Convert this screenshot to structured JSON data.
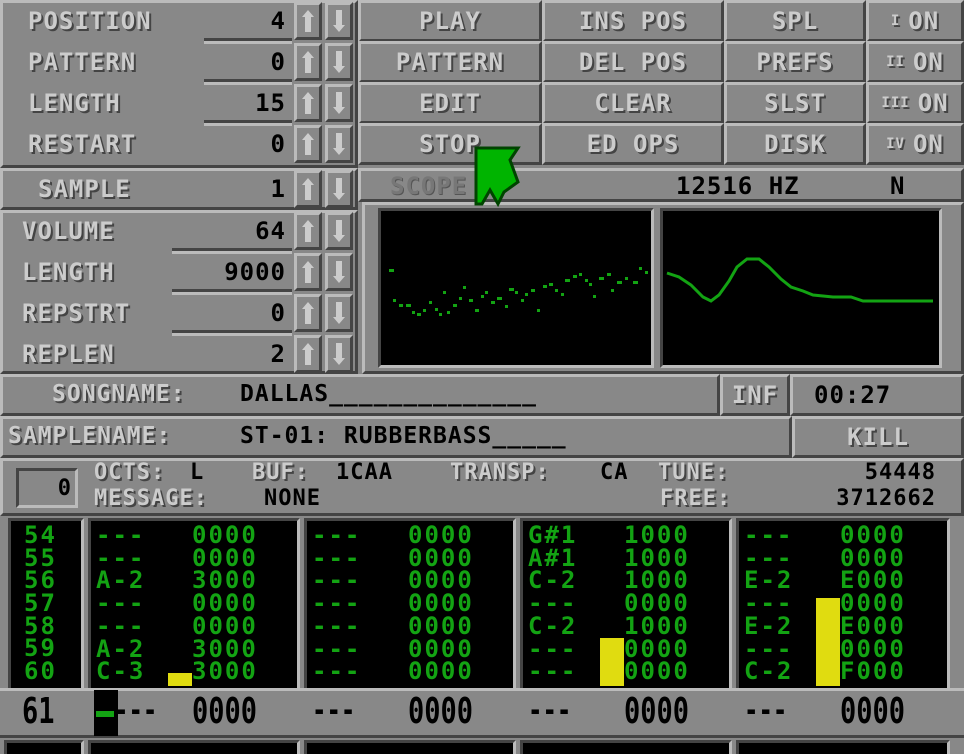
{
  "song_controls": [
    {
      "label": "POSITION",
      "value": "4"
    },
    {
      "label": "PATTERN",
      "value": "0"
    },
    {
      "label": "LENGTH",
      "value": "15"
    },
    {
      "label": "RESTART",
      "value": "0"
    }
  ],
  "transport_buttons": [
    "PLAY",
    "PATTERN",
    "EDIT",
    "STOP"
  ],
  "edit_buttons": [
    "INS POS",
    "DEL POS",
    "CLEAR",
    "ED OPS"
  ],
  "menu_buttons": [
    "SPL",
    "PREFS",
    "SLST",
    "DISK"
  ],
  "channel_toggles": [
    {
      "roman": "I",
      "state": "ON"
    },
    {
      "roman": "II",
      "state": "ON"
    },
    {
      "roman": "III",
      "state": "ON"
    },
    {
      "roman": "IV",
      "state": "ON"
    }
  ],
  "sample": {
    "label": "SAMPLE",
    "value": "1"
  },
  "sample_controls": [
    {
      "label": "VOLUME",
      "value": "64"
    },
    {
      "label": "LENGTH",
      "value": "9000"
    },
    {
      "label": "REPSTRT",
      "value": "0"
    },
    {
      "label": "REPLEN",
      "value": "2"
    }
  ],
  "scope": {
    "label": "SCOPE",
    "frequency": "12516 HZ",
    "mode": "N"
  },
  "songname": {
    "label": "SONGNAME:",
    "value": "DALLAS______________"
  },
  "inf_button": "INF",
  "time": "00:27",
  "samplename": {
    "label": "SAMPLENAME:",
    "value": "ST-01: RUBBERBASS_____"
  },
  "kill_button": "KILL",
  "status": {
    "octave_box": "0",
    "octs_label": "OCTS:",
    "octs_value": "L",
    "buf_label": "BUF:",
    "buf_value": "1CAA",
    "transp_label": "TRANSP:",
    "transp_value": "CA",
    "tune_label": "TUNE:",
    "tune_value": "54448",
    "message_label": "MESSAGE:",
    "message_value": "NONE",
    "free_label": "FREE:",
    "free_value": "3712662"
  },
  "pattern": {
    "row_numbers": [
      "54",
      "55",
      "56",
      "57",
      "58",
      "59",
      "60"
    ],
    "channels": [
      {
        "notes": [
          "---",
          "---",
          "A-2",
          "---",
          "---",
          "A-2",
          "C-3"
        ],
        "effects": [
          "0000",
          "0000",
          "3000",
          "0000",
          "0000",
          "3000",
          "3000"
        ],
        "vu_level": 0.08
      },
      {
        "notes": [
          "---",
          "---",
          "---",
          "---",
          "---",
          "---",
          "---"
        ],
        "effects": [
          "0000",
          "0000",
          "0000",
          "0000",
          "0000",
          "0000",
          "0000"
        ],
        "vu_level": 0
      },
      {
        "notes": [
          "G#1",
          "A#1",
          "C-2",
          "---",
          "C-2",
          "---",
          "---"
        ],
        "effects": [
          "1000",
          "1000",
          "1000",
          "0000",
          "1000",
          "0000",
          "0000"
        ],
        "vu_level": 0.3
      },
      {
        "notes": [
          "---",
          "---",
          "E-2",
          "---",
          "E-2",
          "---",
          "C-2"
        ],
        "effects": [
          "0000",
          "0000",
          "E000",
          "0000",
          "E000",
          "0000",
          "F000"
        ],
        "vu_level": 0.55
      }
    ],
    "current_row": {
      "number": "61",
      "cells": [
        {
          "note": "---",
          "effect": "0000"
        },
        {
          "note": "---",
          "effect": "0000"
        },
        {
          "note": "---",
          "effect": "0000"
        },
        {
          "note": "---",
          "effect": "0000"
        }
      ]
    }
  },
  "colors": {
    "background": "#888888",
    "pattern_text": "#13a313",
    "vu": "#e0dc10",
    "pointer": "#00b400"
  }
}
